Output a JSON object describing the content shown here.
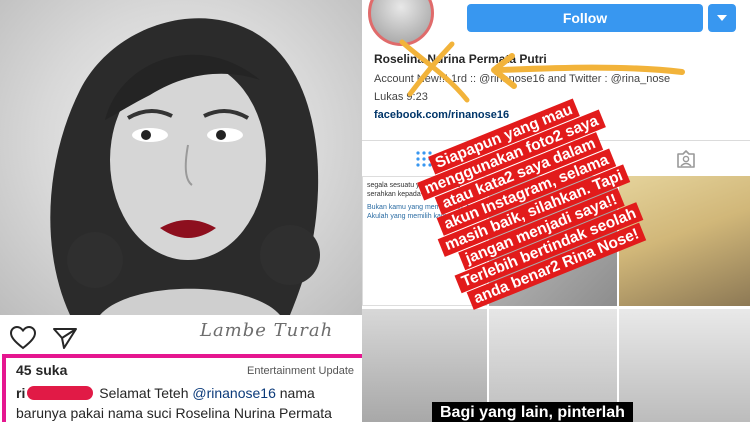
{
  "left": {
    "likes": "45 suka",
    "source_label": "Entertainment Update",
    "watermark": "Lambe Turah",
    "caption_user_prefix": "ri",
    "caption_before_mention": "Selamat Teteh",
    "mention": "@rinanose16",
    "caption_after_mention": "nama barunya pakai nama suci Roselina Nurina Permata"
  },
  "profile": {
    "follow_label": "Follow",
    "name": "Roselina Nurina Permata Putri",
    "bio_line": "Account New!!! 1rd :: @rinanose16 and Twitter : @rina_nose",
    "verse": "Lukas 9:23",
    "link": "facebook.com/rinanose16"
  },
  "grid": {
    "text_post_line1": "segala sesuatu yang Bapa-Ku serahkan kepada-Ku",
    "text_post_line2": "Bukan kamu yang memilih Aku, tetapi Akulah yang memilih kamu",
    "bottom_banner": "Bagi yang lain, pinterlah"
  },
  "note": {
    "lines": [
      "Siapapun yang mau",
      "menggunakan foto2 saya",
      "atau kata2 saya dalam",
      "akun Instagram, selama",
      "masih baik, silahkan. Tapi",
      "jangan menjadi saya!!",
      "Terlebih bertindak seolah",
      "anda benar2 Rina Nose!"
    ]
  },
  "colors": {
    "follow_blue": "#3897f0",
    "note_red": "#e21b1b",
    "highlight_magenta": "#e5168f",
    "scribble_yellow": "#f2b33a"
  },
  "icons": [
    "heart-icon",
    "send-icon",
    "grid-icon",
    "tagged-icon",
    "chevron-down-icon"
  ]
}
